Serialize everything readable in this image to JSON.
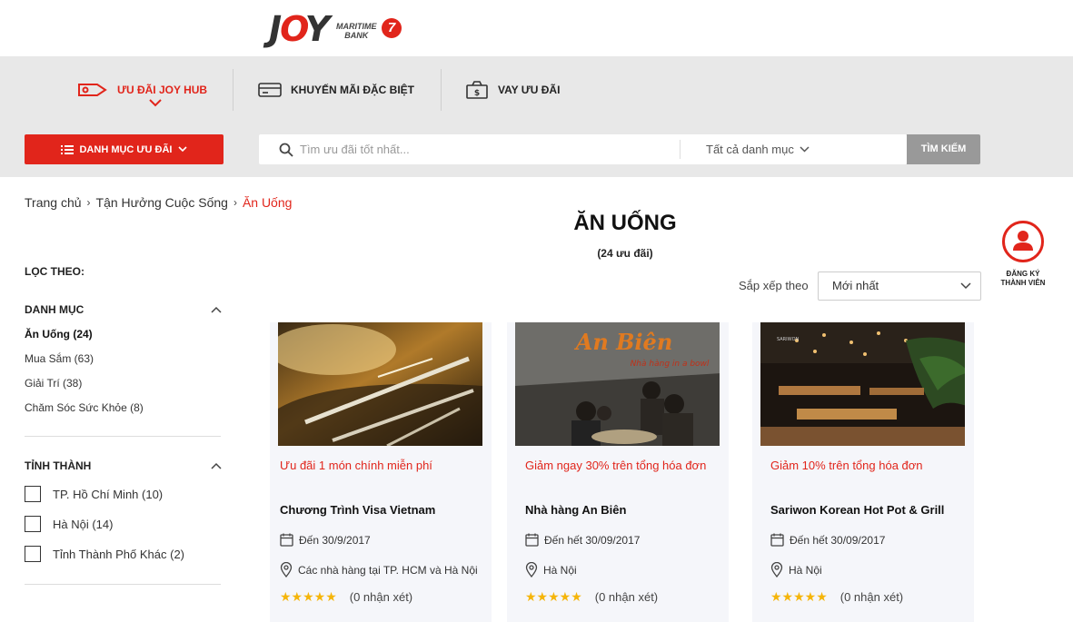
{
  "brand": {
    "logo_text": "JOY",
    "bank_line1": "MARITIME",
    "bank_line2": "BANK",
    "bank_badge": "7"
  },
  "nav": {
    "tabs": [
      {
        "label": "ƯU ĐÃI JOY HUB",
        "icon": "tag-icon",
        "active": true
      },
      {
        "label": "KHUYẾN MÃI ĐẶC BIỆT",
        "icon": "card-icon",
        "active": false
      },
      {
        "label": "VAY ƯU ĐÃI",
        "icon": "money-bag-icon",
        "active": false
      }
    ],
    "category_button": "DANH MỤC ƯU ĐÃI",
    "search_placeholder": "Tìm ưu đãi tốt nhất...",
    "search_category": "Tất cả danh mục",
    "search_button": "TÌM KIẾM"
  },
  "breadcrumb": [
    "Trang chủ",
    "Tận Hưởng Cuộc Sống",
    "Ăn Uống"
  ],
  "page": {
    "title": "ĂN UỐNG",
    "count": "(24 ưu đãi)",
    "sort_label": "Sắp xếp theo",
    "sort_value": "Mới nhất"
  },
  "register": {
    "line1": "ĐĂNG KÝ",
    "line2": "THÀNH VIÊN"
  },
  "sidebar": {
    "filter_title": "LỌC THEO:",
    "category_title": "DANH MỤC",
    "categories": [
      {
        "label": "Ăn Uống (24)",
        "active": true
      },
      {
        "label": "Mua Sắm (63)",
        "active": false
      },
      {
        "label": "Giải Trí (38)",
        "active": false
      },
      {
        "label": "Chăm Sóc Sức Khỏe (8)",
        "active": false
      }
    ],
    "province_title": "TỈNH THÀNH",
    "provinces": [
      {
        "label": "TP. Hồ Chí Minh (10)"
      },
      {
        "label": "Hà Nội (14)"
      },
      {
        "label": "Tỉnh Thành Phố Khác (2)"
      }
    ]
  },
  "cards": [
    {
      "offer": "Ưu đãi 1 món chính miễn phí",
      "name": "Chương Trình Visa Vietnam",
      "date": "Đến 30/9/2017",
      "location": "Các nhà hàng tại TP. HCM và Hà Nội",
      "stars": "★★★★★",
      "reviews": "(0 nhận xét)"
    },
    {
      "offer": "Giảm ngay 30% trên tổng hóa đơn",
      "name": "Nhà hàng An Biên",
      "date": "Đến hết 30/09/2017",
      "location": "Hà Nội",
      "stars": "★★★★★",
      "reviews": "(0 nhận xét)",
      "img_sign": "An Biên",
      "img_sub": "Nhà hàng in a bowl"
    },
    {
      "offer": "Giảm 10% trên tổng hóa đơn",
      "name": "Sariwon Korean Hot Pot & Grill",
      "date": "Đến hết 30/09/2017",
      "location": "Hà Nội",
      "stars": "★★★★★",
      "reviews": "(0 nhận xét)",
      "img_sign": "SARIWON"
    }
  ],
  "colors": {
    "accent": "#e1251b",
    "nav_bg": "#e8e8e8",
    "search_btn": "#999999",
    "star": "#f5b50a",
    "card_bg": "#f5f6fa"
  }
}
